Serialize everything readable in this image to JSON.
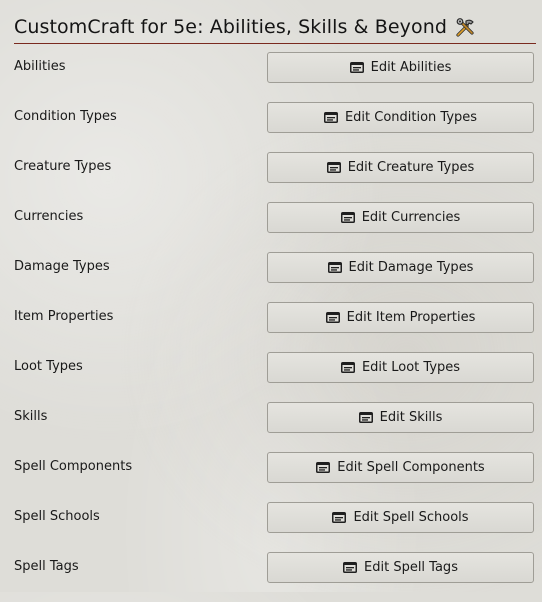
{
  "header": {
    "title": "CustomCraft for 5e: Abilities, Skills & Beyond",
    "icon": "tools-icon"
  },
  "button_icon": "edit-list-icon",
  "rows": [
    {
      "label": "Abilities",
      "button": "Edit Abilities"
    },
    {
      "label": "Condition Types",
      "button": "Edit Condition Types"
    },
    {
      "label": "Creature Types",
      "button": "Edit Creature Types"
    },
    {
      "label": "Currencies",
      "button": "Edit Currencies"
    },
    {
      "label": "Damage Types",
      "button": "Edit Damage Types"
    },
    {
      "label": "Item Properties",
      "button": "Edit Item Properties"
    },
    {
      "label": "Loot Types",
      "button": "Edit Loot Types"
    },
    {
      "label": "Skills",
      "button": "Edit Skills"
    },
    {
      "label": "Spell Components",
      "button": "Edit Spell Components"
    },
    {
      "label": "Spell Schools",
      "button": "Edit Spell Schools"
    },
    {
      "label": "Spell Tags",
      "button": "Edit Spell Tags"
    }
  ]
}
